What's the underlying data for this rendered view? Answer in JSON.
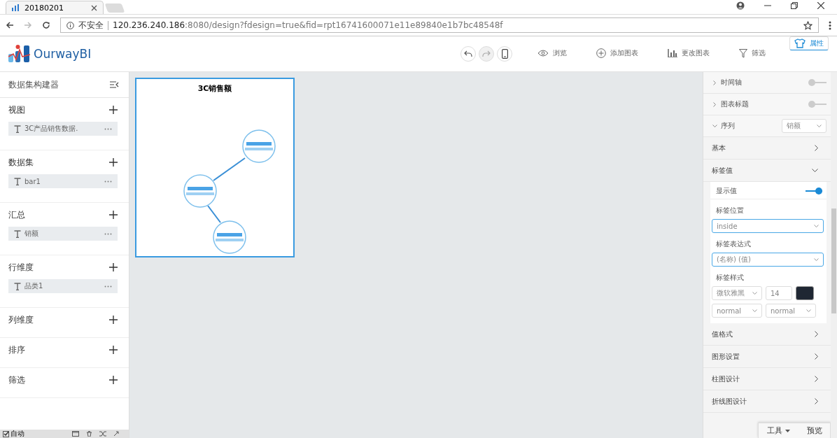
{
  "browser": {
    "tab_title": "20180201",
    "security": "不安全",
    "url_host": "120.236.240.186",
    "url_rest": ":8080/design?fdesign=true&fid=rpt16741600071e11e89840e1b7bc48548f"
  },
  "app": {
    "brand": "OurwayBI",
    "history": [
      {
        "kind": "undo",
        "disabled": false
      },
      {
        "kind": "redo",
        "disabled": true
      },
      {
        "kind": "mobile",
        "disabled": false
      }
    ],
    "toolbar": [
      {
        "kind": "eye",
        "label": "浏览",
        "selected": false
      },
      {
        "kind": "add",
        "label": "添加图表",
        "selected": false
      },
      {
        "kind": "bars",
        "label": "更改图表",
        "selected": false
      },
      {
        "kind": "filter",
        "label": "筛选",
        "selected": false
      },
      {
        "kind": "shirt",
        "label": "属性",
        "selected": true
      }
    ]
  },
  "sidebar": {
    "title": "数据集构建器",
    "sections": [
      {
        "title": "视图",
        "items": [
          "3C产品销售数据."
        ]
      },
      {
        "title": "数据集",
        "items": [
          "bar1"
        ]
      },
      {
        "title": "汇总",
        "items": [
          "销额"
        ]
      },
      {
        "title": "行维度",
        "items": [
          "品类1"
        ]
      },
      {
        "title": "列维度"
      },
      {
        "title": "排序"
      },
      {
        "title": "筛选"
      }
    ],
    "auto": {
      "label": "自动",
      "checked": true
    }
  },
  "chart": {
    "title": "3C销售额"
  },
  "properties": {
    "top_rows": [
      {
        "kind": "toggle",
        "label": "时间轴",
        "expanded": false,
        "on": false
      },
      {
        "kind": "toggle",
        "label": "图表标题",
        "expanded": false,
        "on": false
      },
      {
        "kind": "select",
        "label": "序列",
        "expanded": true,
        "value": "销额"
      }
    ],
    "sections": [
      {
        "label": "基本",
        "expanded": false
      },
      {
        "label": "标签值",
        "expanded": true
      },
      {
        "label": "值格式",
        "expanded": false
      },
      {
        "label": "图形设置",
        "expanded": false
      },
      {
        "label": "柱图设计",
        "expanded": false
      },
      {
        "label": "折线图设计",
        "expanded": false
      }
    ],
    "label_panel": {
      "show_label": "显示值",
      "show_on": true,
      "position_label": "标签位置",
      "position_value": "inside",
      "position_focused": true,
      "expression_label": "标签表达式",
      "expression_value": "(名称) (值)",
      "expression_focused": true,
      "style_label": "标签样式",
      "font": "微软雅黑",
      "size": "14",
      "color": "#1f2733",
      "weight": "normal",
      "font_style": "normal"
    },
    "footer_buttons": [
      {
        "label": "工具",
        "caret": true
      },
      {
        "label": "预览",
        "caret": false
      }
    ]
  }
}
